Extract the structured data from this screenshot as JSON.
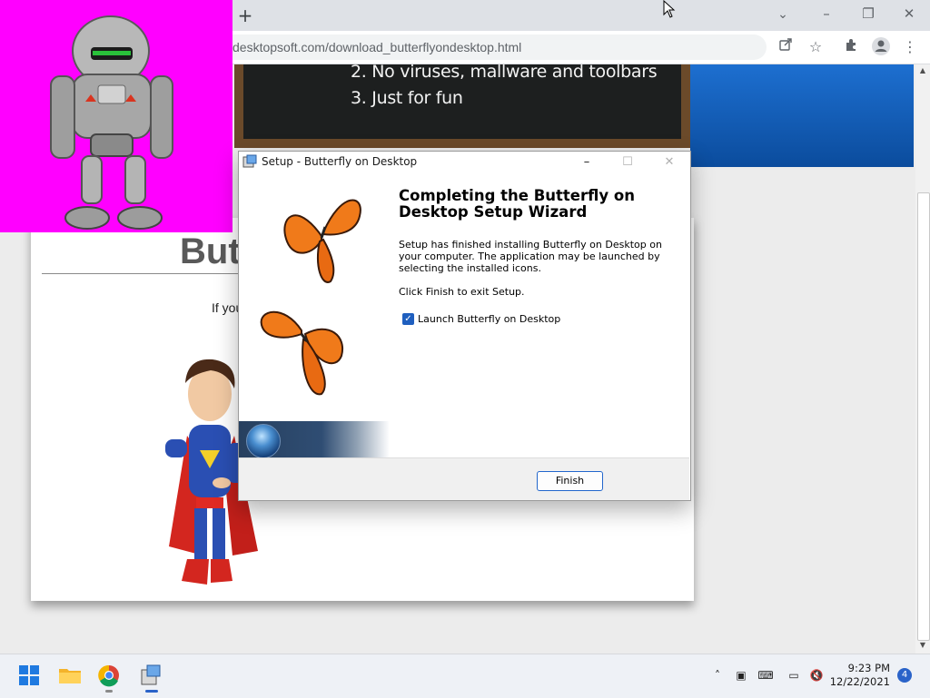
{
  "browser": {
    "new_tab_label": "+",
    "tab_search_icon": "chevron-down-icon",
    "window_buttons": [
      "–",
      "❐",
      "✕"
    ],
    "url": "desktopsoft.com/download_butterflyondesktop.html",
    "toolbar_icons": [
      "share-icon",
      "star-icon",
      "extensions-icon",
      "profile-icon",
      "menu-icon"
    ]
  },
  "page": {
    "board_lines": [
      "2. No viruses, mallware and toolbars",
      "3. Just for fun"
    ],
    "title_fragment": "Butt",
    "text_fragment": "If you"
  },
  "dialog": {
    "title": "Setup - Butterfly on Desktop",
    "heading": "Completing the Butterfly on Desktop Setup Wizard",
    "body": "Setup has finished installing Butterfly on Desktop on your computer. The application may be launched by selecting the installed icons.",
    "finish_instruction": "Click Finish to exit Setup.",
    "launch_checkbox_label": "Launch Butterfly on Desktop",
    "launch_checked": true,
    "finish_button": "Finish"
  },
  "taskbar": {
    "apps": [
      "windows-start-icon",
      "file-explorer-icon",
      "chrome-icon",
      "setup-app-icon"
    ],
    "tray_icons": [
      "chevron-up-icon",
      "network-icon",
      "keyboard-icon",
      "display-icon",
      "volume-muted-icon"
    ],
    "time": "9:23 PM",
    "date": "12/22/2021",
    "notification_count": "4"
  },
  "colors": {
    "robot_background": "#ff00ff",
    "page_banner": "#0b4c9d",
    "finish_button_border": "#2266cc",
    "checkbox": "#1f5fbf"
  }
}
